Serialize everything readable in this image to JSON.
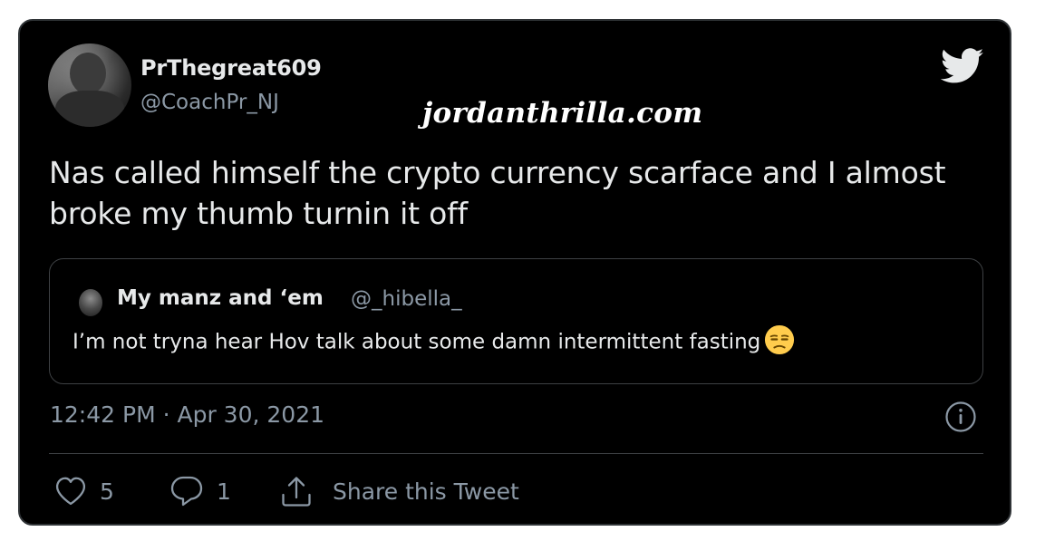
{
  "tweet": {
    "display_name": "PrThegreat609",
    "handle": "@CoachPr_NJ",
    "text": "Nas called himself the crypto currency scarface and I almost broke my thumb turnin it off",
    "timestamp": "12:42 PM · Apr 30, 2021",
    "watermark": "jordanthrilla.com",
    "icons": {
      "brand": "twitter-bird-icon",
      "info": "info-icon"
    }
  },
  "quoted_tweet": {
    "display_name": "My manz and ‘em",
    "handle": "@_hibella_",
    "text": "I’m not tryna hear Hov talk about some damn intermittent fasting",
    "emoji": "unamused-face-emoji"
  },
  "actions": {
    "like_count": "5",
    "reply_count": "1",
    "share_label": "Share this Tweet"
  },
  "colors": {
    "card_bg": "#000000",
    "primary_text": "#e7e9ea",
    "secondary_text": "#8b98a5",
    "border": "#3e4144"
  }
}
